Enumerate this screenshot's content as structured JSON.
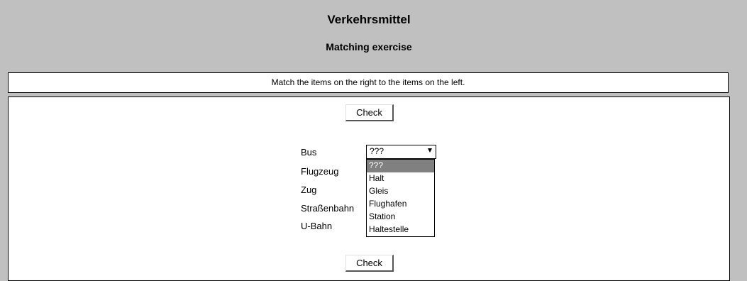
{
  "header": {
    "title": "Verkehrsmittel",
    "subtitle": "Matching exercise"
  },
  "instructions": "Match the items on the right to the items on the left.",
  "buttons": {
    "check_top": "Check",
    "check_bottom": "Check"
  },
  "terms": [
    "Bus",
    "Flugzeug",
    "Zug",
    "Straßenbahn",
    "U-Bahn"
  ],
  "select": {
    "value": "???",
    "options": [
      "???",
      "Halt",
      "Gleis",
      "Flughafen",
      "Station",
      "Haltestelle"
    ],
    "highlighted_index": 0
  }
}
